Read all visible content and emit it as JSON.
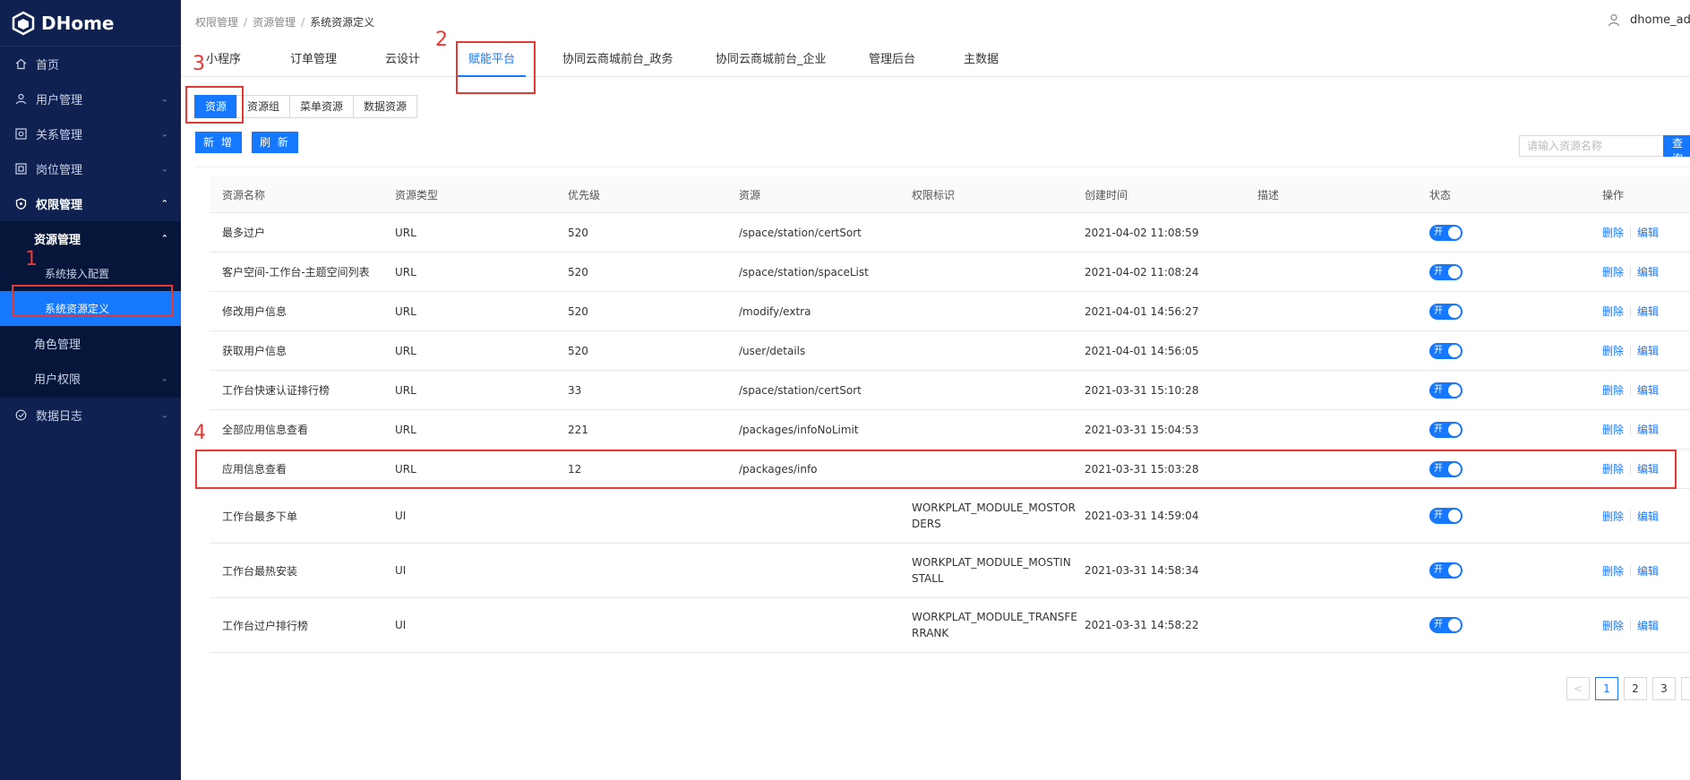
{
  "app": {
    "title": "DHome"
  },
  "sidebar": {
    "items": [
      {
        "label": "首页",
        "icon": "home-icon"
      },
      {
        "label": "用户管理",
        "icon": "user-icon"
      },
      {
        "label": "关系管理",
        "icon": "relation-icon"
      },
      {
        "label": "岗位管理",
        "icon": "post-icon"
      },
      {
        "label": "权限管理",
        "icon": "shield-icon"
      },
      {
        "label": "数据日志",
        "icon": "log-icon"
      }
    ],
    "sub": {
      "resource_mgmt": "资源管理",
      "system_access": "系统接入配置",
      "system_resource_def": "系统资源定义",
      "role_mgmt": "角色管理",
      "user_permission": "用户权限"
    }
  },
  "breadcrumb": [
    "权限管理",
    "资源管理",
    "系统资源定义"
  ],
  "breadcrumb_sep": "/",
  "user": {
    "name": "dhome_adm"
  },
  "tabs": [
    "小程序",
    "订单管理",
    "云设计",
    "赋能平台",
    "协同云商城前台_政务",
    "协同云商城前台_企业",
    "管理后台",
    "主数据"
  ],
  "active_tab": "赋能平台",
  "segments": [
    "资源",
    "资源组",
    "菜单资源",
    "数据资源"
  ],
  "toolbar": {
    "add_label": "新 增",
    "refresh_label": "刷 新"
  },
  "search": {
    "placeholder": "请输入资源名称",
    "button_label": "查 询"
  },
  "table": {
    "columns": [
      "资源名称",
      "资源类型",
      "优先级",
      "资源",
      "权限标识",
      "创建时间",
      "描述",
      "状态",
      "操作"
    ],
    "rows": [
      {
        "name": "最多过户",
        "type": "URL",
        "priority": "520",
        "resource": "/space/station/certSort",
        "perm": "",
        "created": "2021-04-02 11:08:59",
        "desc": "",
        "status": "开"
      },
      {
        "name": "客户空间-工作台-主题空间列表",
        "type": "URL",
        "priority": "520",
        "resource": "/space/station/spaceList",
        "perm": "",
        "created": "2021-04-02 11:08:24",
        "desc": "",
        "status": "开"
      },
      {
        "name": "修改用户信息",
        "type": "URL",
        "priority": "520",
        "resource": "/modify/extra",
        "perm": "",
        "created": "2021-04-01 14:56:27",
        "desc": "",
        "status": "开"
      },
      {
        "name": "获取用户信息",
        "type": "URL",
        "priority": "520",
        "resource": "/user/details",
        "perm": "",
        "created": "2021-04-01 14:56:05",
        "desc": "",
        "status": "开"
      },
      {
        "name": "工作台快速认证排行榜",
        "type": "URL",
        "priority": "33",
        "resource": "/space/station/certSort",
        "perm": "",
        "created": "2021-03-31 15:10:28",
        "desc": "",
        "status": "开"
      },
      {
        "name": "全部应用信息查看",
        "type": "URL",
        "priority": "221",
        "resource": "/packages/infoNoLimit",
        "perm": "",
        "created": "2021-03-31 15:04:53",
        "desc": "",
        "status": "开"
      },
      {
        "name": "应用信息查看",
        "type": "URL",
        "priority": "12",
        "resource": "/packages/info",
        "perm": "",
        "created": "2021-03-31 15:03:28",
        "desc": "",
        "status": "开"
      },
      {
        "name": "工作台最多下单",
        "type": "UI",
        "priority": "",
        "resource": "",
        "perm": "WORKPLAT_MODULE_MOSTORDERS",
        "created": "2021-03-31 14:59:04",
        "desc": "",
        "status": "开"
      },
      {
        "name": "工作台最热安装",
        "type": "UI",
        "priority": "",
        "resource": "",
        "perm": "WORKPLAT_MODULE_MOSTINSTALL",
        "created": "2021-03-31 14:58:34",
        "desc": "",
        "status": "开"
      },
      {
        "name": "工作台过户排行榜",
        "type": "UI",
        "priority": "",
        "resource": "",
        "perm": "WORKPLAT_MODULE_TRANSFERRANK",
        "created": "2021-03-31 14:58:22",
        "desc": "",
        "status": "开"
      }
    ],
    "actions": {
      "delete": "删除",
      "edit": "编辑"
    }
  },
  "pagination": {
    "prev": "<",
    "pages": [
      "1",
      "2",
      "3"
    ],
    "current": "1"
  },
  "annotations": [
    "1",
    "2",
    "3",
    "4"
  ],
  "colors": {
    "sidebar_bg": "#0e2150",
    "accent": "#1677ff",
    "annotation": "#e53935"
  }
}
